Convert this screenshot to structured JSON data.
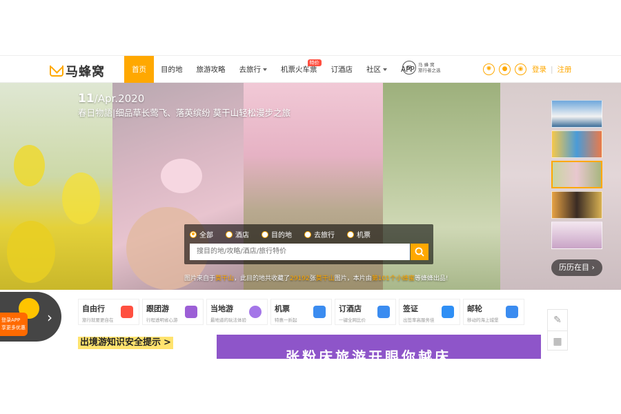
{
  "header": {
    "logo_text": "马蜂窝",
    "nav": [
      {
        "label": "首页",
        "active": true
      },
      {
        "label": "目的地"
      },
      {
        "label": "旅游攻略"
      },
      {
        "label": "去旅行",
        "caret": true
      },
      {
        "label": "机票火车票",
        "badge": "特价"
      },
      {
        "label": "订酒店"
      },
      {
        "label": "社区",
        "caret": true
      },
      {
        "label": "APP"
      }
    ],
    "seal_char": "马",
    "seal_line1": "马 蜂 窝",
    "seal_line2": "旅行者之选",
    "social_icons": [
      "weibo-icon",
      "qq-icon",
      "wechat-icon"
    ],
    "login": "登录",
    "register": "注册"
  },
  "hero": {
    "date_day": "11",
    "date_rest": "/Apr.2020",
    "title": "春日物語|细品草长莺飞、落英缤纷 莫干山轻松漫步之旅",
    "credit_prefix": "图片来自于",
    "credit_place": "莫干山",
    "credit_mid1": "，此目的地共收藏了",
    "credit_count": "29192",
    "credit_mid2": "张",
    "credit_place2": "莫干山",
    "credit_mid3": "图片，本片由",
    "credit_author": "第101个小蜂蜜",
    "credit_suffix": "等蜂蜂出品!",
    "more_label": "历历在目 ›"
  },
  "search": {
    "tabs": [
      "全部",
      "酒店",
      "目的地",
      "去旅行",
      "机票"
    ],
    "placeholder": "搜目的地/攻略/酒店/旅行特价"
  },
  "services": [
    {
      "name": "自由行",
      "desc": "旅行就要更自在",
      "color": "#ff5040"
    },
    {
      "name": "跟团游",
      "desc": "行程透明省心游",
      "color": "#9c5fd6"
    },
    {
      "name": "当地游",
      "desc": "最地道的玩法体验",
      "color": "#a476e8"
    },
    {
      "name": "机票",
      "desc": "特惠一折起",
      "color": "#3b8cf0"
    },
    {
      "name": "订酒店",
      "desc": "一键全网比价",
      "color": "#3b8cf0"
    },
    {
      "name": "签证",
      "desc": "出签率高服务佳",
      "color": "#2f8ff5"
    },
    {
      "name": "邮轮",
      "desc": "移动的海上城堡",
      "color": "#3b8cf0"
    }
  ],
  "app_tab": {
    "line1": "登录APP",
    "line2": "享更多优惠"
  },
  "tips": "出境游知识安全提示",
  "promo_text": "张粉床旅游开眼你越床"
}
